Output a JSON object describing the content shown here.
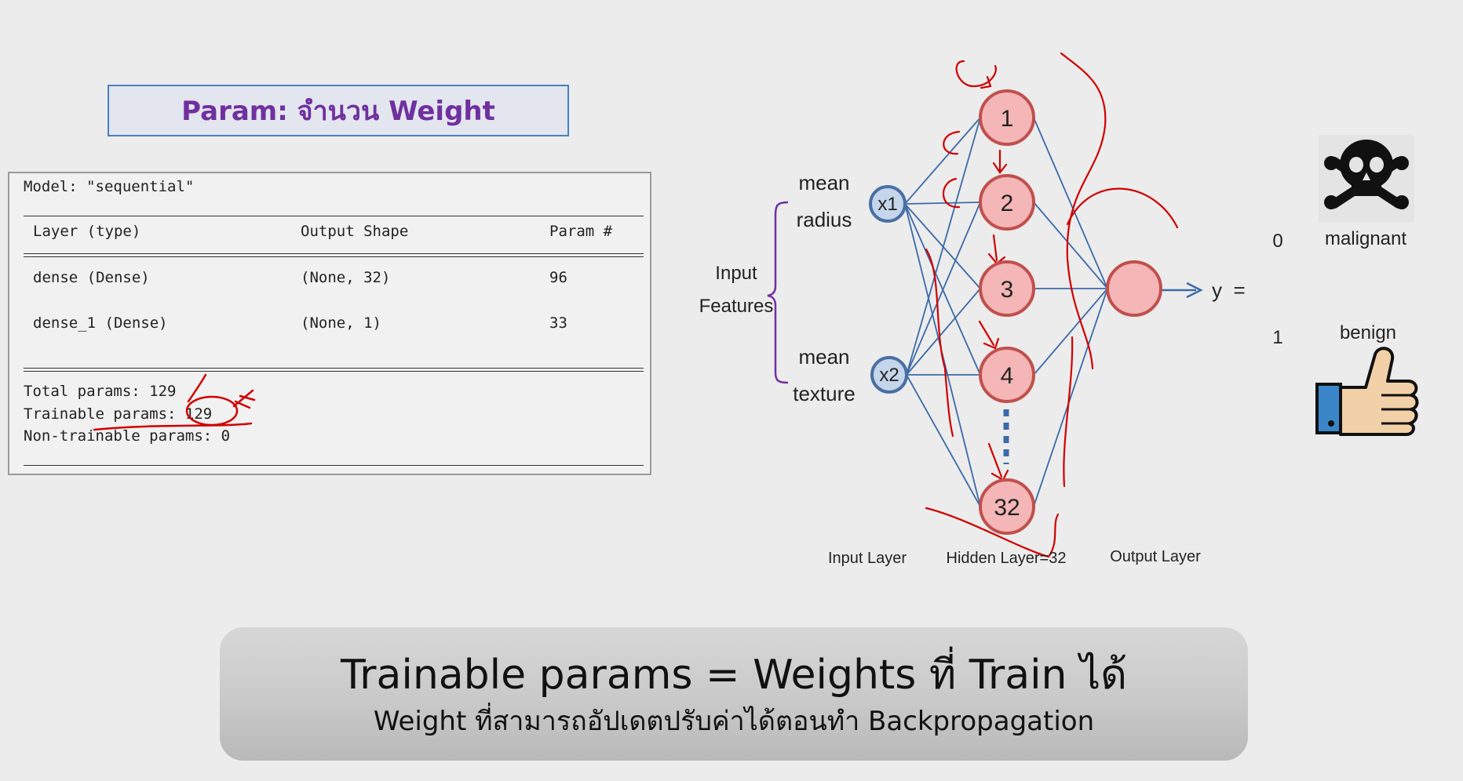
{
  "title": "Param: จำนวน Weight",
  "summary": {
    "model_line": "Model: \"sequential\"",
    "headers": {
      "layer": "Layer (type)",
      "shape": "Output Shape",
      "param": "Param #"
    },
    "rows": [
      {
        "layer": "dense (Dense)",
        "shape": "(None, 32)",
        "param": "96"
      },
      {
        "layer": "dense_1 (Dense)",
        "shape": "(None, 1)",
        "param": "33"
      }
    ],
    "total": "Total params: 129",
    "trainable": "Trainable params: 129",
    "non_trainable": "Non-trainable params: 0"
  },
  "diagram": {
    "input_label_top": "mean",
    "input_label_top2": "radius",
    "input_label_bottom": "mean",
    "input_label_bottom2": "texture",
    "features_label_1": "Input",
    "features_label_2": "Features",
    "inputs": [
      "x1",
      "x2"
    ],
    "hidden": [
      "1",
      "2",
      "3",
      "4",
      "32"
    ],
    "output_eq": "y  =",
    "class_0_value": "0",
    "class_0_name": "malignant",
    "class_1_value": "1",
    "class_1_name": "benign",
    "layer_input": "Input Layer",
    "layer_hidden": "Hidden Layer=32",
    "layer_output": "Output Layer",
    "colors": {
      "input_fill": "#c5d5ea",
      "input_stroke": "#4a6fa5",
      "hidden_fill": "#f4b6b6",
      "hidden_stroke": "#c0504d",
      "edge": "#3b6aa8",
      "annotation": "#d00000"
    },
    "icons": [
      "skull-crossbones-icon",
      "thumbs-up-icon"
    ]
  },
  "banner": {
    "main": "Trainable params = Weights ที่ Train ได้",
    "sub": "Weight ที่สามารถอัปเดตปรับค่าได้ตอนทำ Backpropagation"
  }
}
